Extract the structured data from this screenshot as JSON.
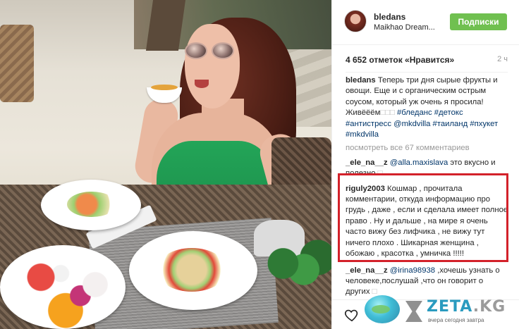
{
  "post": {
    "username": "bledans",
    "location": "Maikhao Dream...",
    "follow_label": "Подписки",
    "likes": "4 652 отметок «Нравится»",
    "time": "2 ч"
  },
  "caption": {
    "user": "bledans",
    "text": "Теперь три дня сырые фрукты и овощи. Еще и с органическим острым соусом, который уж очень я просила! Живёёём",
    "emoji_placeholder": "□□□",
    "tags": [
      "#бледанс",
      "#детокс",
      "#антистресс",
      "@mkdvilla",
      "#таиланд",
      "#пхукет",
      "#mkdvilla"
    ]
  },
  "view_all": "посмотреть все 67 комментариев",
  "comments": [
    {
      "user": "_ele_na__z",
      "mention": "@alla.maxislava",
      "text": "это вкусно и полезно",
      "emoji": "□"
    },
    {
      "user": "riguly2003",
      "text": "Кошмар , прочитала комментарии, откуда информацию про грудь , даже , если и сделала имеет полное право . Ну и дальше , на мире я очень часто вижу без лифчика , не вижу тут ничего плохо . Шикарная женщина , обожаю , красотка , умничка !!!!!"
    },
    {
      "user": "_ele_na__z",
      "mention": "@irina98938",
      "text": ",хочешь узнать о человеке,послушай ,что он говорит о других",
      "emoji": "□"
    }
  ],
  "watermark": {
    "brand": "ZETA",
    "suffix": ".KG",
    "slogan": "вчера сегодня завтра"
  },
  "colors": {
    "follow_button": "#70c050",
    "highlight_border": "#d3212a",
    "tag_link": "#003569"
  }
}
